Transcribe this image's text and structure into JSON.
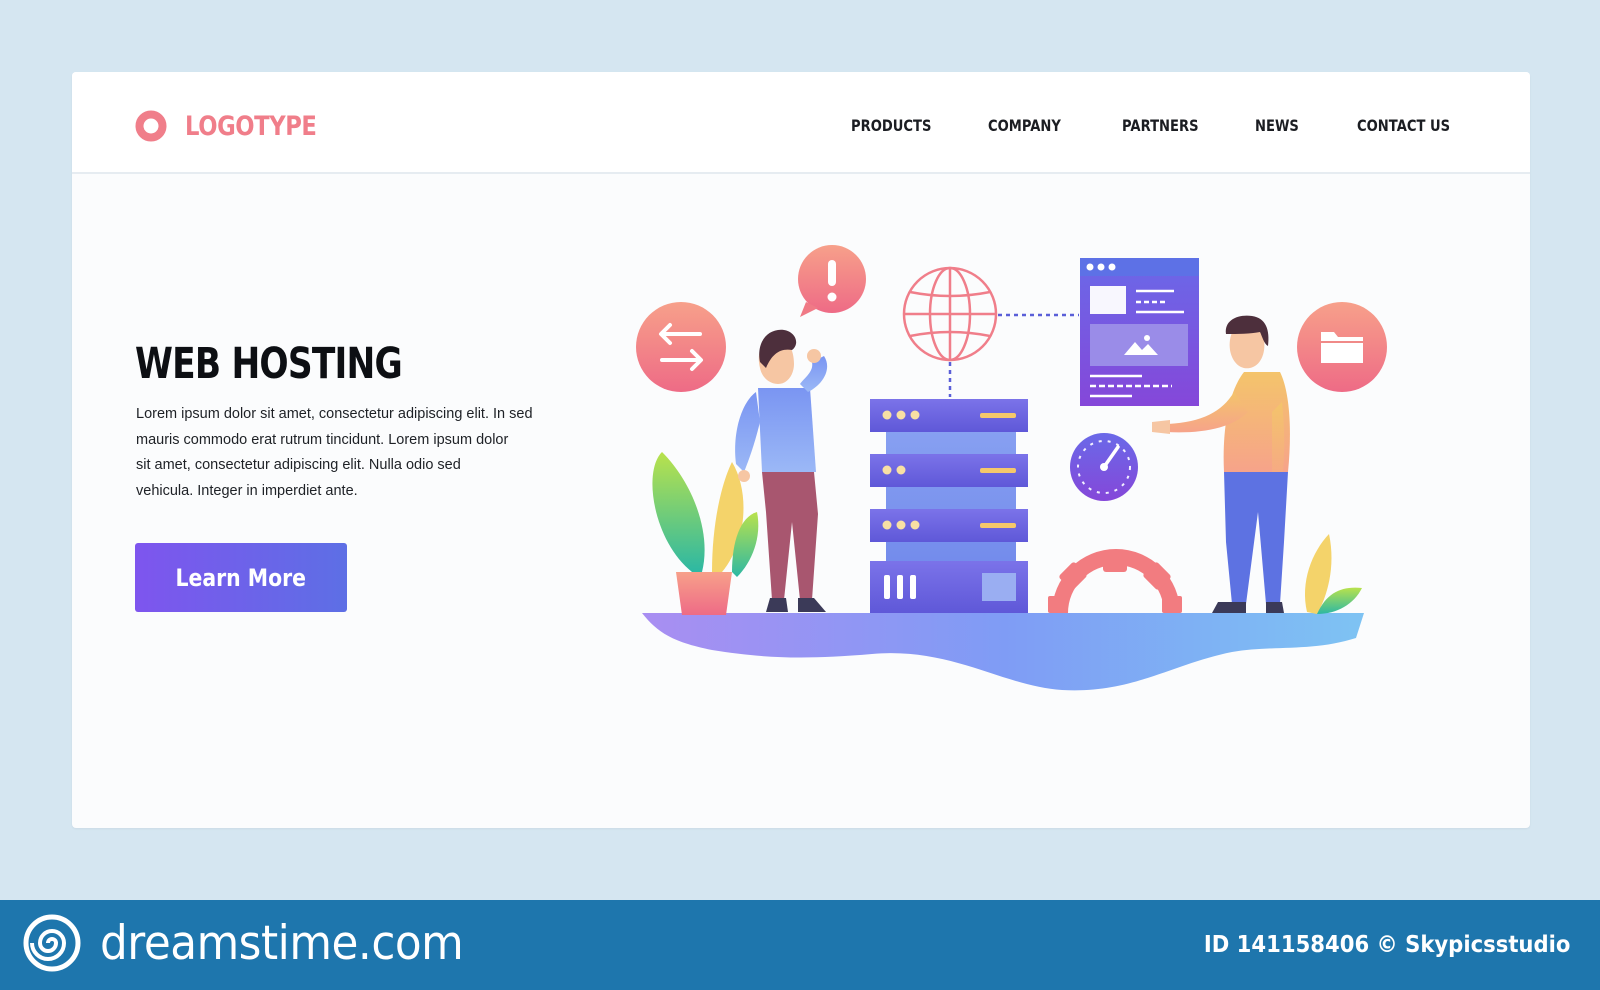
{
  "header": {
    "logo_text": "LOGOTYPE",
    "nav": [
      "PRODUCTS",
      "COMPANY",
      "PARTNERS",
      "NEWS",
      "CONTACT US"
    ]
  },
  "hero": {
    "title": "WEB HOSTING",
    "body_lines": [
      "Lorem ipsum dolor sit amet, consectetur adipiscing elit. In sed",
      "mauris commodo erat rutrum tincidunt. Lorem ipsum dolor",
      "sit amet, consectetur adipiscing elit. Nulla  odio sed",
      "vehicula. Integer in imperdiet ante."
    ],
    "cta_label": "Learn More"
  },
  "illustration": {
    "icons": [
      "exchange-arrows-icon",
      "alert-bubble-icon",
      "globe-icon",
      "browser-window-icon",
      "folder-icon",
      "speedometer-icon",
      "gear-icon",
      "server-rack-icon",
      "plant-icon"
    ]
  },
  "footer": {
    "brand": "dreamstime.com",
    "credit": "ID 141158406 © Skypicsstudio"
  },
  "colors": {
    "background": "#d5e6f1",
    "logo": "#f07e8a",
    "accent": "#7e55ee",
    "footer": "#1e76ad"
  }
}
